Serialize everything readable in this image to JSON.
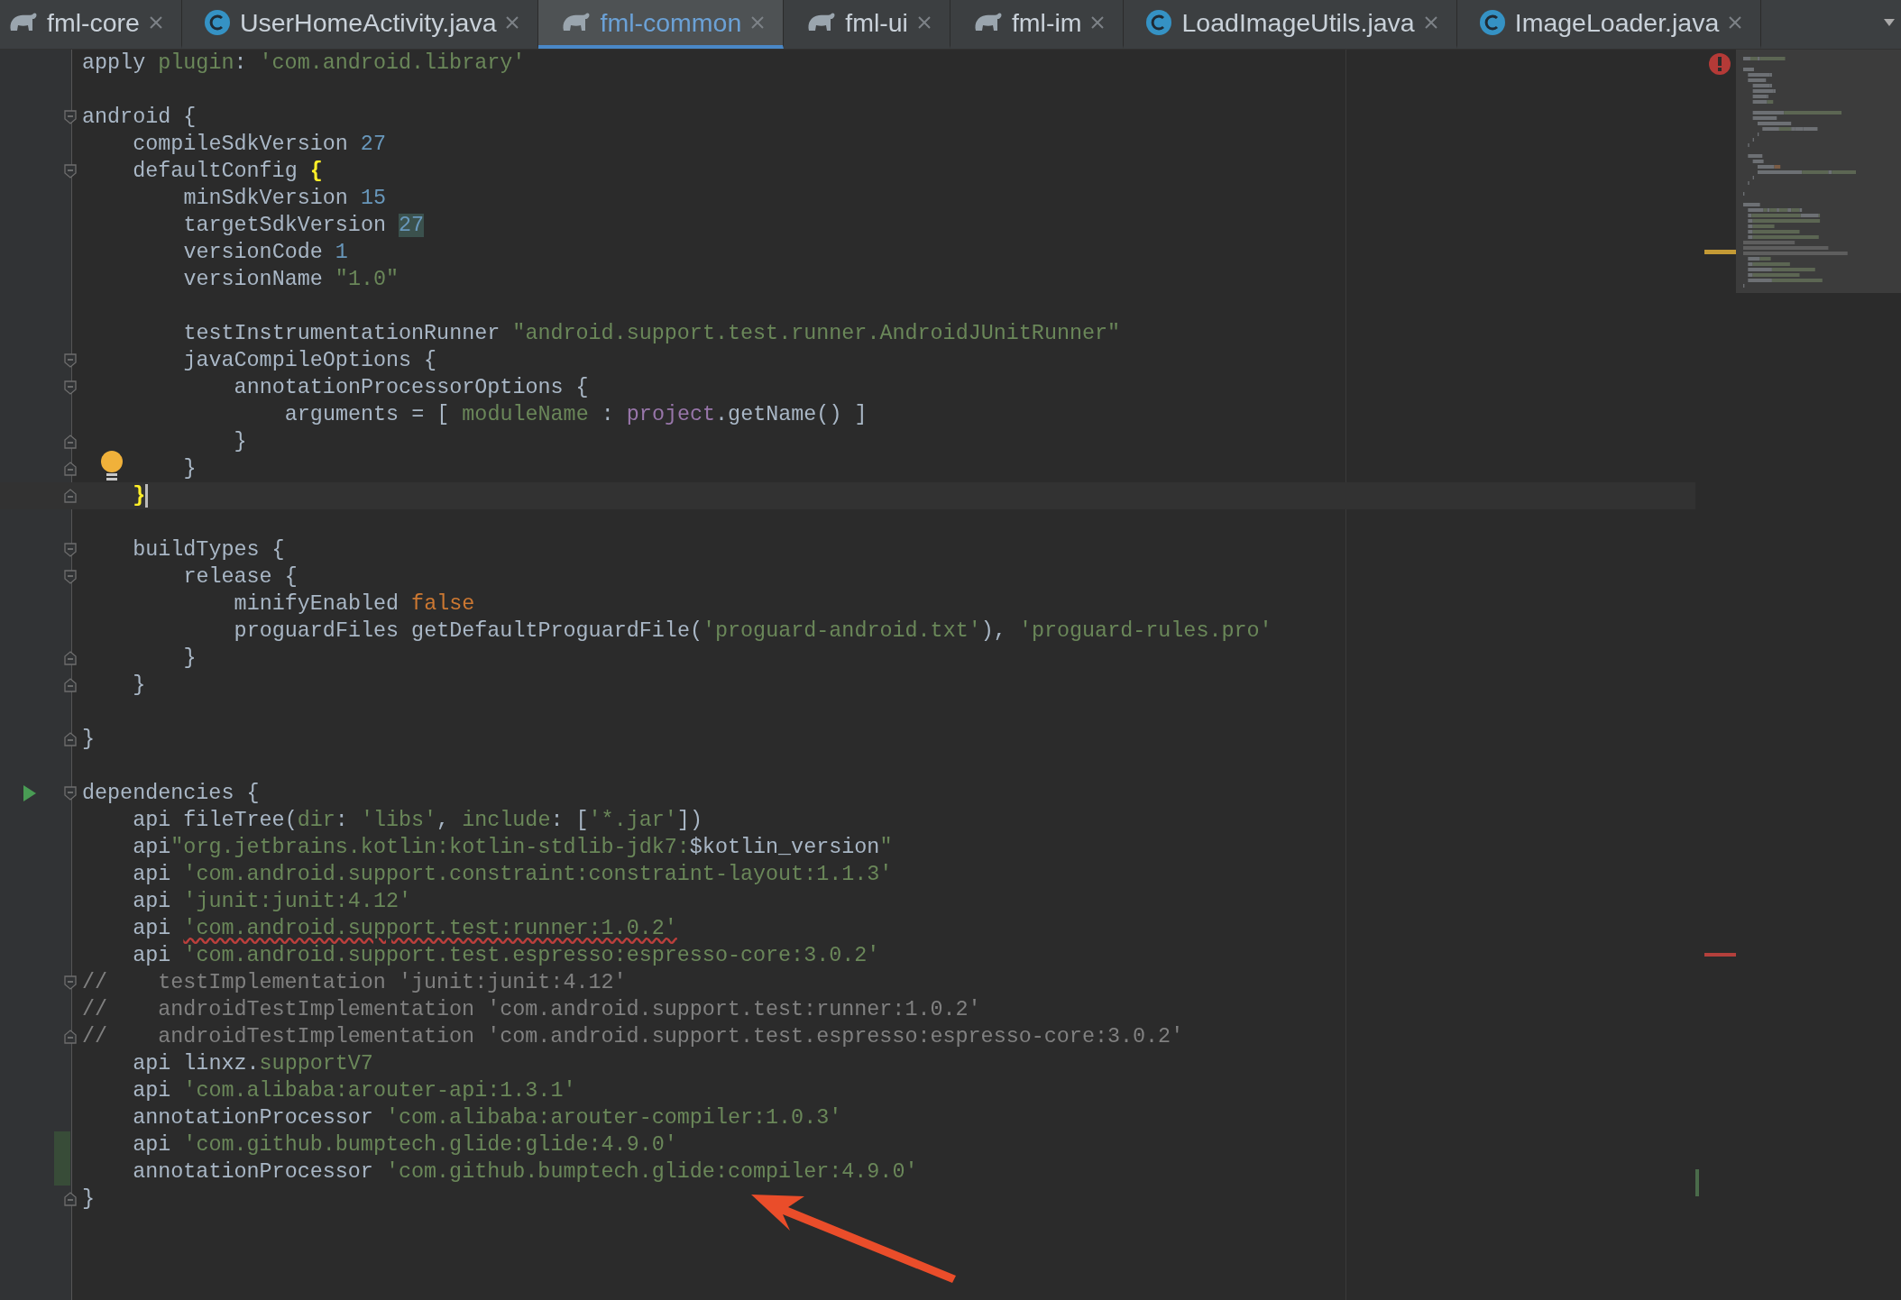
{
  "tabs": [
    {
      "label": "fml-core",
      "kind": "gradle",
      "selected": false
    },
    {
      "label": "UserHomeActivity.java",
      "kind": "class",
      "selected": false
    },
    {
      "label": "fml-common",
      "kind": "gradle",
      "selected": true
    },
    {
      "label": "fml-ui",
      "kind": "gradle",
      "selected": false
    },
    {
      "label": "fml-im",
      "kind": "gradle",
      "selected": false
    },
    {
      "label": "LoadImageUtils.java",
      "kind": "class",
      "selected": false
    },
    {
      "label": "ImageLoader.java",
      "kind": "class",
      "selected": false
    }
  ],
  "editor": {
    "lines": [
      {
        "current": false,
        "tokens": [
          {
            "kind": "plain",
            "text": "apply "
          },
          {
            "kind": "param",
            "text": "plugin"
          },
          {
            "kind": "plain",
            "text": ": "
          },
          {
            "kind": "string",
            "text": "'com.android.library'"
          }
        ]
      },
      {
        "current": false
      },
      {
        "current": false,
        "gutter": [
          {
            "kind": "fold-start"
          }
        ],
        "tokens": [
          {
            "kind": "plain",
            "text": "android {"
          }
        ]
      },
      {
        "current": false,
        "tokens": [
          {
            "kind": "plain",
            "text": "    compileSdkVersion "
          },
          {
            "kind": "number",
            "text": "27"
          }
        ]
      },
      {
        "current": false,
        "gutter": [
          {
            "kind": "fold-start"
          }
        ],
        "tokens": [
          {
            "kind": "plain",
            "text": "    defaultConfig "
          },
          {
            "kind": "brace-match",
            "text": "{"
          }
        ]
      },
      {
        "current": false,
        "tokens": [
          {
            "kind": "plain",
            "text": "        minSdkVersion "
          },
          {
            "kind": "number",
            "text": "15"
          }
        ]
      },
      {
        "current": false,
        "tokens": [
          {
            "kind": "plain",
            "text": "        targetSdkVersion "
          },
          {
            "kind": "number-match",
            "text": "27"
          }
        ]
      },
      {
        "current": false,
        "tokens": [
          {
            "kind": "plain",
            "text": "        versionCode "
          },
          {
            "kind": "number",
            "text": "1"
          }
        ]
      },
      {
        "current": false,
        "tokens": [
          {
            "kind": "plain",
            "text": "        versionName "
          },
          {
            "kind": "string",
            "text": "\"1.0\""
          }
        ]
      },
      {
        "current": false
      },
      {
        "current": false,
        "tokens": [
          {
            "kind": "plain",
            "text": "        testInstrumentationRunner "
          },
          {
            "kind": "string",
            "text": "\"android.support.test.runner.AndroidJUnitRunner\""
          }
        ]
      },
      {
        "current": false,
        "gutter": [
          {
            "kind": "fold-start"
          }
        ],
        "tokens": [
          {
            "kind": "plain",
            "text": "        javaCompileOptions {"
          }
        ]
      },
      {
        "current": false,
        "gutter": [
          {
            "kind": "fold-start"
          }
        ],
        "tokens": [
          {
            "kind": "plain",
            "text": "            annotationProcessorOptions {"
          }
        ]
      },
      {
        "current": false,
        "tokens": [
          {
            "kind": "plain",
            "text": "                arguments = [ "
          },
          {
            "kind": "param",
            "text": "moduleName"
          },
          {
            "kind": "plain",
            "text": " : "
          },
          {
            "kind": "field",
            "text": "project"
          },
          {
            "kind": "plain",
            "text": ".getName() ]"
          }
        ]
      },
      {
        "current": false,
        "gutter": [
          {
            "kind": "fold-end"
          }
        ],
        "tokens": [
          {
            "kind": "plain",
            "text": "            }"
          }
        ]
      },
      {
        "current": false,
        "gutter": [
          {
            "kind": "fold-end"
          },
          {
            "kind": "bulb"
          }
        ],
        "tokens": [
          {
            "kind": "plain",
            "text": "        }"
          }
        ]
      },
      {
        "current": true,
        "gutter": [
          {
            "kind": "fold-end"
          }
        ],
        "tokens": [
          {
            "kind": "brace-match",
            "text": "    }"
          }
        ]
      },
      {
        "current": false
      },
      {
        "current": false,
        "gutter": [
          {
            "kind": "fold-start"
          }
        ],
        "tokens": [
          {
            "kind": "plain",
            "text": "    buildTypes {"
          }
        ]
      },
      {
        "current": false,
        "gutter": [
          {
            "kind": "fold-start"
          }
        ],
        "tokens": [
          {
            "kind": "plain",
            "text": "        release {"
          }
        ]
      },
      {
        "current": false,
        "tokens": [
          {
            "kind": "plain",
            "text": "            minifyEnabled "
          },
          {
            "kind": "keyword",
            "text": "false"
          }
        ]
      },
      {
        "current": false,
        "tokens": [
          {
            "kind": "plain",
            "text": "            proguardFiles getDefaultProguardFile("
          },
          {
            "kind": "string",
            "text": "'proguard-android.txt'"
          },
          {
            "kind": "plain",
            "text": "), "
          },
          {
            "kind": "string",
            "text": "'proguard-rules.pro'"
          }
        ]
      },
      {
        "current": false,
        "gutter": [
          {
            "kind": "fold-end"
          }
        ],
        "tokens": [
          {
            "kind": "plain",
            "text": "        }"
          }
        ]
      },
      {
        "current": false,
        "gutter": [
          {
            "kind": "fold-end"
          }
        ],
        "tokens": [
          {
            "kind": "plain",
            "text": "    }"
          }
        ]
      },
      {
        "current": false
      },
      {
        "current": false,
        "gutter": [
          {
            "kind": "fold-end"
          }
        ],
        "tokens": [
          {
            "kind": "plain",
            "text": "}"
          }
        ]
      },
      {
        "current": false
      },
      {
        "current": false,
        "gutter": [
          {
            "kind": "run"
          },
          {
            "kind": "fold-start"
          }
        ],
        "tokens": [
          {
            "kind": "plain",
            "text": "dependencies {"
          }
        ]
      },
      {
        "current": false,
        "tokens": [
          {
            "kind": "plain",
            "text": "    api fileTree("
          },
          {
            "kind": "param",
            "text": "dir"
          },
          {
            "kind": "plain",
            "text": ": "
          },
          {
            "kind": "string",
            "text": "'libs'"
          },
          {
            "kind": "plain",
            "text": ", "
          },
          {
            "kind": "param",
            "text": "include"
          },
          {
            "kind": "plain",
            "text": ": ["
          },
          {
            "kind": "string",
            "text": "'*.jar'"
          },
          {
            "kind": "plain",
            "text": "])"
          }
        ]
      },
      {
        "current": false,
        "tokens": [
          {
            "kind": "plain",
            "text": "    api"
          },
          {
            "kind": "string",
            "text": "\"org.jetbrains.kotlin:kotlin-stdlib-jdk7:"
          },
          {
            "kind": "plain",
            "text": "$kotlin_version"
          },
          {
            "kind": "string",
            "text": "\""
          }
        ]
      },
      {
        "current": false,
        "tokens": [
          {
            "kind": "plain",
            "text": "    api "
          },
          {
            "kind": "string",
            "text": "'com.android.support.constraint:constraint-layout:1.1.3'"
          }
        ]
      },
      {
        "current": false,
        "tokens": [
          {
            "kind": "plain",
            "text": "    api "
          },
          {
            "kind": "string",
            "text": "'junit:junit:4.12'"
          }
        ]
      },
      {
        "current": false,
        "tokens": [
          {
            "kind": "plain",
            "text": "    api "
          },
          {
            "kind": "string-error",
            "text": "'com.android.support.test:runner:1.0.2'"
          }
        ]
      },
      {
        "current": false,
        "tokens": [
          {
            "kind": "plain",
            "text": "    api "
          },
          {
            "kind": "string",
            "text": "'com.android.support.test.espresso:espresso-core:3.0.2'"
          }
        ]
      },
      {
        "current": false,
        "gutter": [
          {
            "kind": "fold-start"
          }
        ],
        "tokens": [
          {
            "kind": "comment",
            "text": "//    testImplementation 'junit:junit:4.12'"
          }
        ]
      },
      {
        "current": false,
        "tokens": [
          {
            "kind": "comment",
            "text": "//    androidTestImplementation 'com.android.support.test:runner:1.0.2'"
          }
        ]
      },
      {
        "current": false,
        "gutter": [
          {
            "kind": "fold-end"
          }
        ],
        "tokens": [
          {
            "kind": "comment",
            "text": "//    androidTestImplementation 'com.android.support.test.espresso:espresso-core:3.0.2'"
          }
        ]
      },
      {
        "current": false,
        "tokens": [
          {
            "kind": "plain",
            "text": "    api linxz."
          },
          {
            "kind": "param",
            "text": "supportV7"
          }
        ]
      },
      {
        "current": false,
        "tokens": [
          {
            "kind": "plain",
            "text": "    api "
          },
          {
            "kind": "string",
            "text": "'com.alibaba:arouter-api:1.3.1'"
          }
        ]
      },
      {
        "current": false,
        "tokens": [
          {
            "kind": "plain",
            "text": "    annotationProcessor "
          },
          {
            "kind": "string",
            "text": "'com.alibaba:arouter-compiler:1.0.3'"
          }
        ]
      },
      {
        "current": false,
        "gutter": [
          {
            "kind": "changed"
          }
        ],
        "tokens": [
          {
            "kind": "plain",
            "text": "    api "
          },
          {
            "kind": "string",
            "text": "'com.github.bumptech.glide:glide:4.9.0'"
          }
        ]
      },
      {
        "current": false,
        "gutter": [
          {
            "kind": "changed"
          }
        ],
        "tokens": [
          {
            "kind": "plain",
            "text": "    annotationProcessor "
          },
          {
            "kind": "string",
            "text": "'com.github.bumptech.glide:compiler:4.9.0'"
          }
        ]
      },
      {
        "current": false,
        "gutter": [
          {
            "kind": "fold-end"
          }
        ],
        "tokens": [
          {
            "kind": "plain",
            "text": "}"
          }
        ]
      }
    ]
  }
}
